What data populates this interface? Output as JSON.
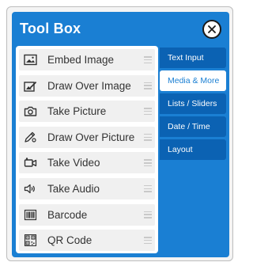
{
  "window": {
    "title": "Tool Box"
  },
  "close_label": "close",
  "items": [
    {
      "label": "Embed Image",
      "icon": "image-icon"
    },
    {
      "label": "Draw Over Image",
      "icon": "draw-image-icon"
    },
    {
      "label": "Take Picture",
      "icon": "camera-icon"
    },
    {
      "label": "Draw Over Picture",
      "icon": "pencil-icon"
    },
    {
      "label": "Take Video",
      "icon": "video-icon"
    },
    {
      "label": "Take Audio",
      "icon": "speaker-icon"
    },
    {
      "label": "Barcode",
      "icon": "barcode-icon"
    },
    {
      "label": "QR Code",
      "icon": "qr-code-icon"
    }
  ],
  "tabs": [
    {
      "label": "Text Input",
      "active": false
    },
    {
      "label": "Media & More",
      "active": true
    },
    {
      "label": "Lists / Sliders",
      "active": false
    },
    {
      "label": "Date / Time",
      "active": false
    },
    {
      "label": "Layout",
      "active": false
    }
  ],
  "colors": {
    "panel_blue": "#1a7fd3",
    "tab_blue": "#0b62b3",
    "active_tab_text": "#1a7fd3"
  }
}
